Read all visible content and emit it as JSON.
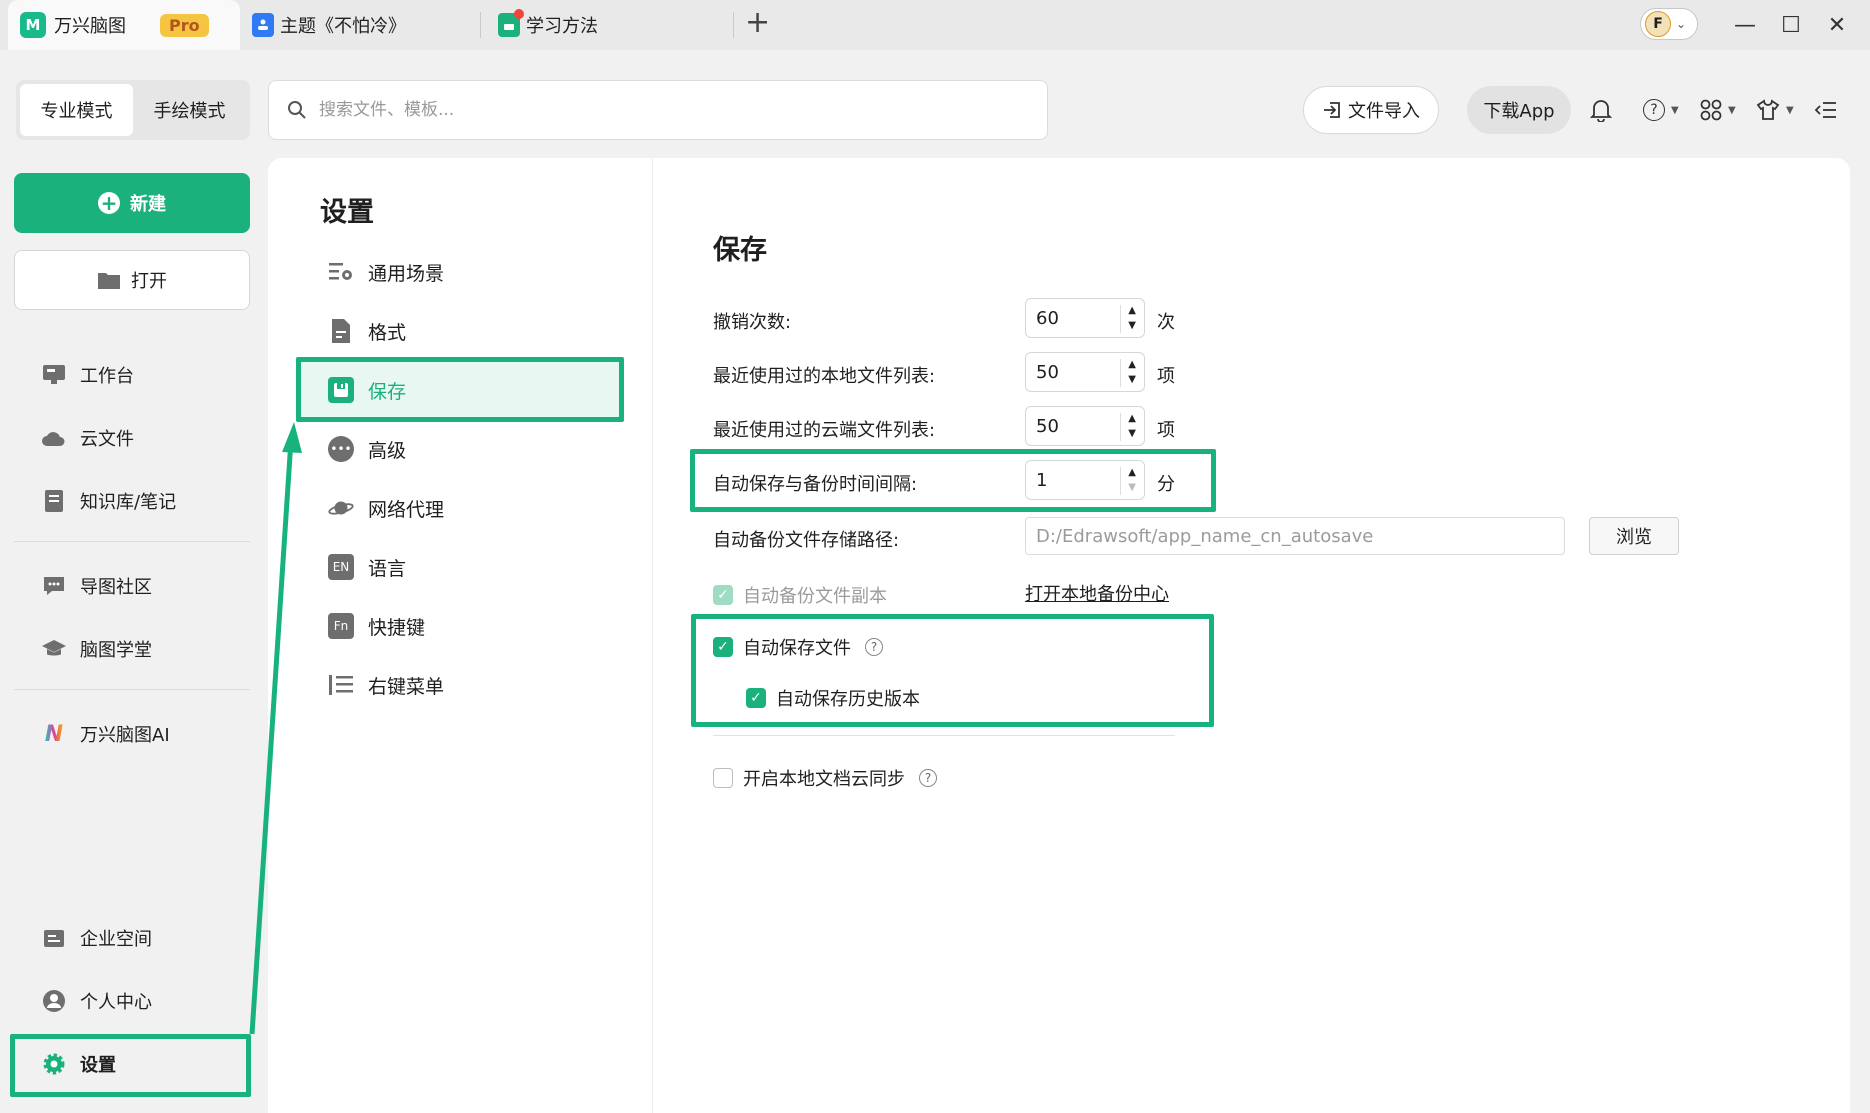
{
  "titlebar": {
    "app_name": "万兴脑图",
    "app_logo_text": "M",
    "pro_badge": "Pro",
    "tabs": [
      {
        "label": "主题《不怕冷》"
      },
      {
        "label": "学习方法"
      }
    ],
    "new_tab": "+",
    "avatar_letter": "F",
    "minimize": "—",
    "maximize": "☐",
    "close": "✕"
  },
  "toolbar": {
    "modes": [
      "专业模式",
      "手绘模式"
    ],
    "search_placeholder": "搜索文件、模板...",
    "import_label": "文件导入",
    "download_label": "下载App"
  },
  "sidebar": {
    "new_label": "新建",
    "open_label": "打开",
    "items": [
      {
        "label": "工作台"
      },
      {
        "label": "云文件"
      },
      {
        "label": "知识库/笔记"
      },
      {
        "label": "导图社区"
      },
      {
        "label": "脑图学堂"
      },
      {
        "label": "万兴脑图AI"
      },
      {
        "label": "企业空间"
      },
      {
        "label": "个人中心"
      },
      {
        "label": "设置"
      }
    ]
  },
  "settings": {
    "title": "设置",
    "nav": [
      {
        "label": "通用场景"
      },
      {
        "label": "格式"
      },
      {
        "label": "保存"
      },
      {
        "label": "高级"
      },
      {
        "label": "网络代理"
      },
      {
        "label": "语言"
      },
      {
        "label": "快捷键"
      },
      {
        "label": "右键菜单"
      }
    ],
    "active_nav": "保存"
  },
  "save": {
    "title": "保存",
    "undo_label": "撤销次数:",
    "undo_value": "60",
    "undo_unit": "次",
    "local_recent_label": "最近使用过的本地文件列表:",
    "local_recent_value": "50",
    "local_recent_unit": "项",
    "cloud_recent_label": "最近使用过的云端文件列表:",
    "cloud_recent_value": "50",
    "cloud_recent_unit": "项",
    "interval_label": "自动保存与备份时间间隔:",
    "interval_value": "1",
    "interval_unit": "分",
    "path_label": "自动备份文件存储路径:",
    "path_value": "D:/Edrawsoft/app_name_cn_autosave",
    "browse_label": "浏览",
    "backup_copy_label": "自动备份文件副本",
    "open_backup_center": "打开本地备份中心",
    "autosave_label": "自动保存文件",
    "autosave_history_label": "自动保存历史版本",
    "cloud_sync_label": "开启本地文档云同步"
  },
  "colors": {
    "accent": "#1ab17c",
    "highlight": "#18b37c",
    "active_bg": "#e8f7f1"
  }
}
